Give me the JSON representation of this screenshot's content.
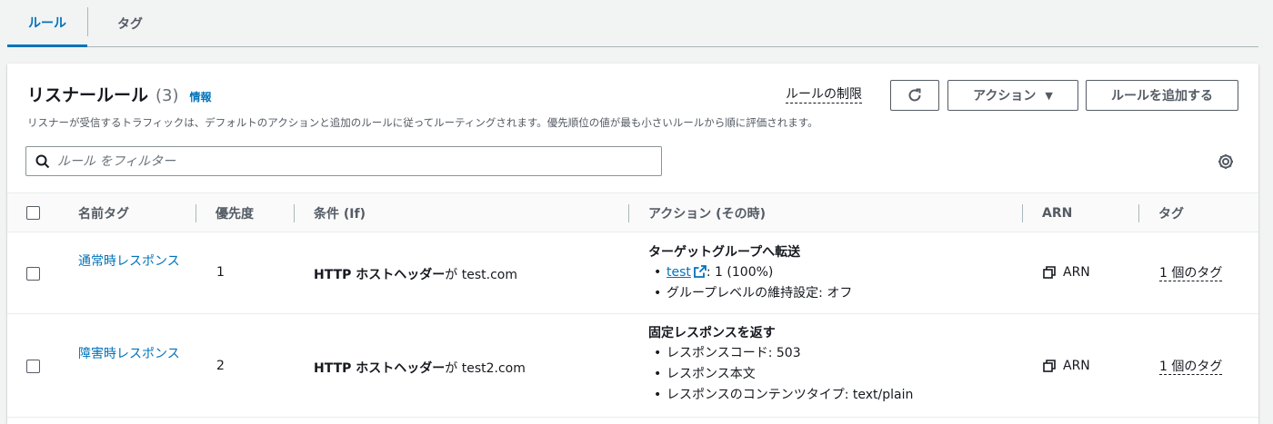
{
  "tabs": [
    {
      "label": "ルール",
      "active": true
    },
    {
      "label": "タグ",
      "active": false
    }
  ],
  "panel": {
    "title": "リスナールール",
    "count": "(3)",
    "info": "情報",
    "description": "リスナーが受信するトラフィックは、デフォルトのアクションと追加のルールに従ってルーティングされます。優先順位の値が最も小さいルールから順に評価されます。",
    "limits_link": "ルールの制限",
    "actions_button": "アクション",
    "add_rule_button": "ルールを追加する",
    "search_placeholder": "ルール をフィルター"
  },
  "table": {
    "columns": [
      "名前タグ",
      "優先度",
      "条件 (If)",
      "アクション (その時)",
      "ARN",
      "タグ"
    ],
    "rows": [
      {
        "name": "通常時レスポンス",
        "priority": "1",
        "condition_strong": "HTTP ホストヘッダー",
        "condition_rest": "が test.com",
        "action_title": "ターゲットグループへ転送",
        "target_link": "test",
        "target_weight": ": 1 (100%)",
        "action_items": [
          "グループレベルの維持設定: オフ"
        ],
        "arn": "ARN",
        "tags": "1 個のタグ"
      },
      {
        "name": "障害時レスポンス",
        "priority": "2",
        "condition_strong": "HTTP ホストヘッダー",
        "condition_rest": "が test2.com",
        "action_title": "固定レスポンスを返す",
        "action_items": [
          "レスポンスコード: 503",
          "レスポンス本文",
          "レスポンスのコンテンツタイプ: text/plain"
        ],
        "arn": "ARN",
        "tags": "1 個のタグ"
      }
    ]
  },
  "colors": {
    "accent": "#0073bb",
    "text": "#16191f",
    "muted": "#545b64",
    "background": "#f2f3f3"
  }
}
